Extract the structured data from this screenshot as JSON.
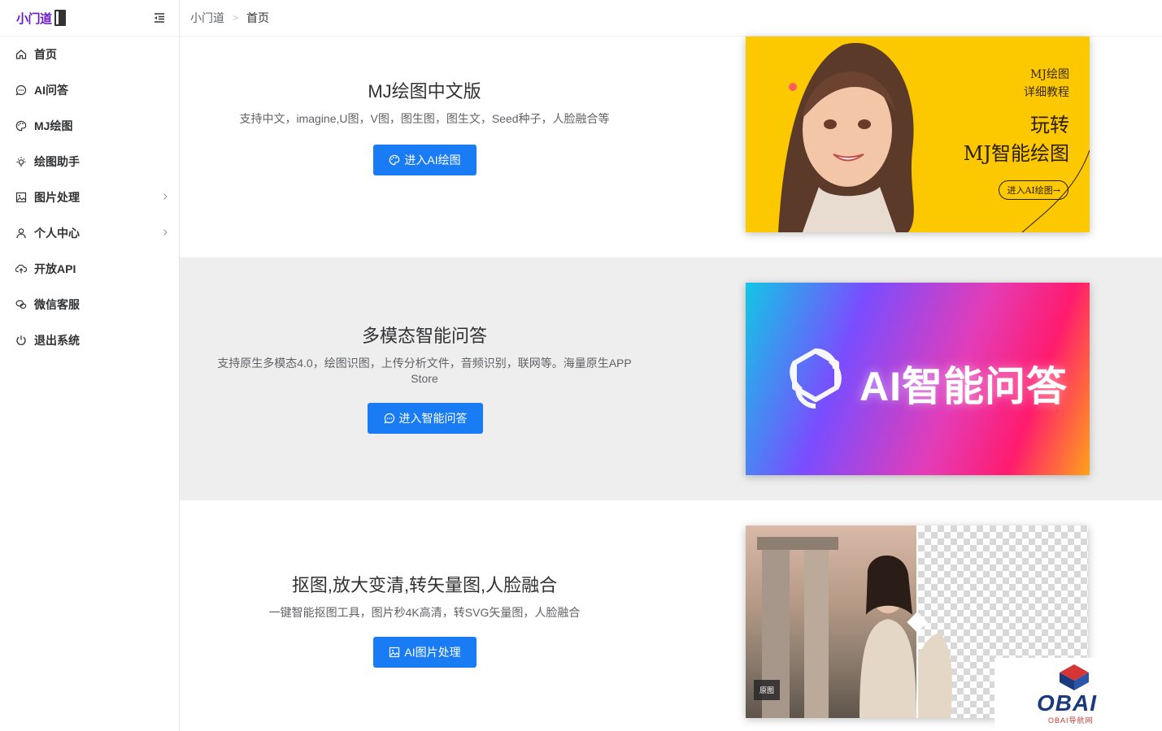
{
  "app": {
    "logo_text": "小门道"
  },
  "breadcrumb": [
    "小门道",
    "首页"
  ],
  "sidebar": {
    "items": [
      {
        "label": "首页",
        "icon": "home-icon",
        "has_arrow": false
      },
      {
        "label": "AI问答",
        "icon": "chat-icon",
        "has_arrow": false
      },
      {
        "label": "MJ绘图",
        "icon": "palette-icon",
        "has_arrow": false
      },
      {
        "label": "绘图助手",
        "icon": "bulb-icon",
        "has_arrow": false
      },
      {
        "label": "图片处理",
        "icon": "picture-icon",
        "has_arrow": true
      },
      {
        "label": "个人中心",
        "icon": "user-icon",
        "has_arrow": true
      },
      {
        "label": "开放API",
        "icon": "upload-cloud-icon",
        "has_arrow": false
      },
      {
        "label": "微信客服",
        "icon": "wechat-icon",
        "has_arrow": false
      },
      {
        "label": "退出系统",
        "icon": "power-icon",
        "has_arrow": false
      }
    ]
  },
  "sections": [
    {
      "title": "MJ绘图中文版",
      "desc": "支持中文，imagine,U图，V图，图生图，图生文，Seed种子，人脸融合等",
      "button": "进入AI绘图",
      "button_icon": "palette-icon",
      "banner": {
        "small_lines": [
          "MJ绘图",
          "详细教程"
        ],
        "big_lines": [
          "玩转",
          "MJ智能绘图"
        ],
        "pill": "进入AI绘图→"
      }
    },
    {
      "title": "多模态智能问答",
      "desc": "支持原生多模态4.0，绘图识图，上传分析文件，音频识别，联网等。海量原生APP Store",
      "button": "进入智能问答",
      "button_icon": "chat-icon",
      "banner": {
        "text": "AI智能问答"
      }
    },
    {
      "title": "抠图,放大变清,转矢量图,人脸融合",
      "desc": "一键智能抠图工具，图片秒4K高清，转SVG矢量图，人脸融合",
      "button": "AI图片处理",
      "button_icon": "picture-icon",
      "banner": {
        "label": "原图"
      }
    }
  ],
  "watermark": {
    "text": "OBAI",
    "sub": "OBAI导航网"
  },
  "colors": {
    "accent": "#1a7cf5",
    "logo": "#6a1bc7",
    "banner1_bg": "#fcc800",
    "section_alt_bg": "#eeeeee"
  }
}
